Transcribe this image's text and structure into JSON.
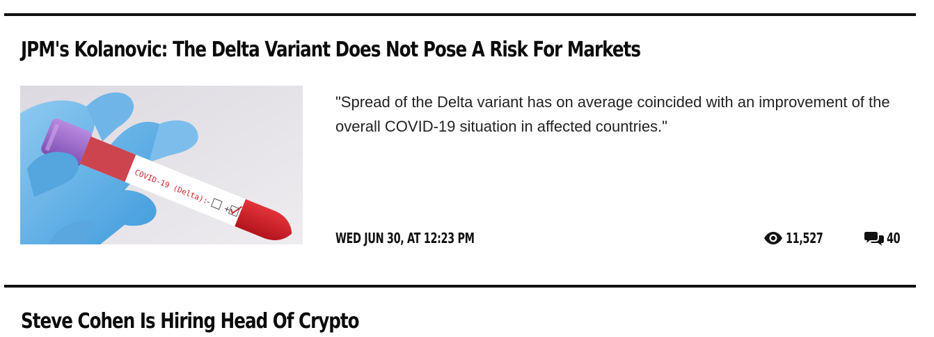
{
  "article": {
    "title": "JPM's Kolanovic: The Delta Variant Does Not Pose A Risk For Markets",
    "excerpt": "\"Spread of the Delta variant has on average coincided with an improvement of the overall COVID-19 situation in affected countries.\"",
    "date": "WED JUN 30, AT 12:23 PM",
    "views": "11,527",
    "comments": "40",
    "thumbnail": {
      "tube_label": "COVID-19 (Delta):",
      "minus_sign": "-",
      "plus_sign": "+"
    }
  },
  "next_article": {
    "title": "Steve Cohen Is Hiring Head Of Crypto"
  },
  "icons": {
    "views": "eye-icon",
    "comments": "comments-icon"
  }
}
